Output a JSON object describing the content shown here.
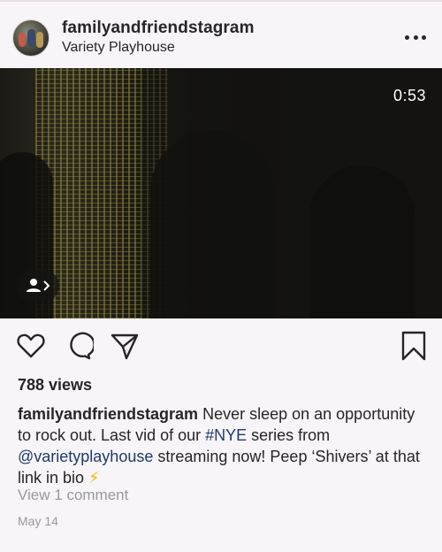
{
  "post": {
    "username": "familyandfriendstagram",
    "location": "Variety Playhouse",
    "video_time": "0:53",
    "views": "788 views",
    "caption": {
      "user": "familyandfriendstagram",
      "part1": " Never sleep on an opportunity to rock out. Last vid of our ",
      "hashtag": "#NYE",
      "part2": " series from ",
      "mention": "@varietyplayhouse",
      "part3": " streaming now! Peep ‘Shivers’ at that link in bio ",
      "emoji": "⚡"
    },
    "view_comments": "View 1 comment",
    "date": "May 14"
  },
  "icons": {
    "more": "more-options-icon",
    "tagged_people": "person-tag-icon",
    "like": "heart-icon",
    "comment": "comment-icon",
    "share": "paper-plane-icon",
    "save": "bookmark-icon"
  },
  "colors": {
    "background": "#f7f5f7",
    "text": "#262626",
    "link": "#1e3a6f",
    "muted": "#9a9a9a",
    "bolt": "#f2b705"
  }
}
